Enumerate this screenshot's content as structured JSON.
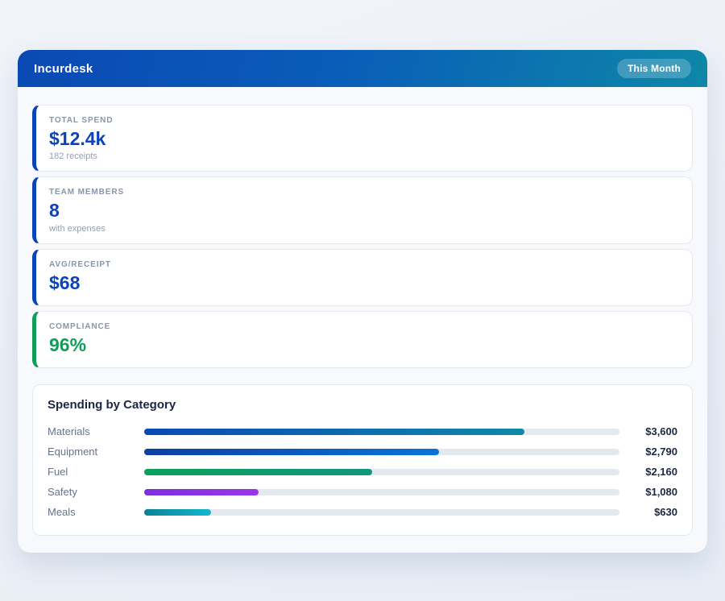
{
  "header": {
    "app_title": "Incurdesk",
    "period_badge": "This Month",
    "gradient": [
      "#0a49b4",
      "#0d87a8"
    ]
  },
  "stats": [
    {
      "label": "TOTAL SPEND",
      "value": "$12.4k",
      "sub": "182 receipts",
      "accent": "#0b44b8",
      "value_color": "#0b44b8"
    },
    {
      "label": "TEAM MEMBERS",
      "value": "8",
      "sub": "with expenses",
      "accent": "#0b44b8",
      "value_color": "#0b44b8"
    },
    {
      "label": "AVG/RECEIPT",
      "value": "$68",
      "sub": "",
      "accent": "#0b44b8",
      "value_color": "#0b44b8"
    },
    {
      "label": "COMPLIANCE",
      "value": "96%",
      "sub": "",
      "accent": "#0f9d58",
      "value_color": "#0f9d58"
    }
  ],
  "spending": {
    "title": "Spending by Category"
  },
  "chart_data": {
    "type": "bar",
    "orientation": "horizontal",
    "title": "Spending by Category",
    "categories": [
      "Materials",
      "Equipment",
      "Fuel",
      "Safety",
      "Meals"
    ],
    "values": [
      3600,
      2790,
      2160,
      1080,
      630
    ],
    "value_labels": [
      "$3,600",
      "$2,790",
      "$2,160",
      "$1,080",
      "$630"
    ],
    "scale_max": 4500,
    "track_color": "#e4e9f0",
    "bar_gradients": [
      [
        "#0b49b5",
        "#0e89a8"
      ],
      [
        "#0d3fa3",
        "#0a74d6"
      ],
      [
        "#0ba15a",
        "#14957e"
      ],
      [
        "#7c30dd",
        "#9b36e9"
      ],
      [
        "#0d8196",
        "#13b7cf"
      ]
    ]
  }
}
